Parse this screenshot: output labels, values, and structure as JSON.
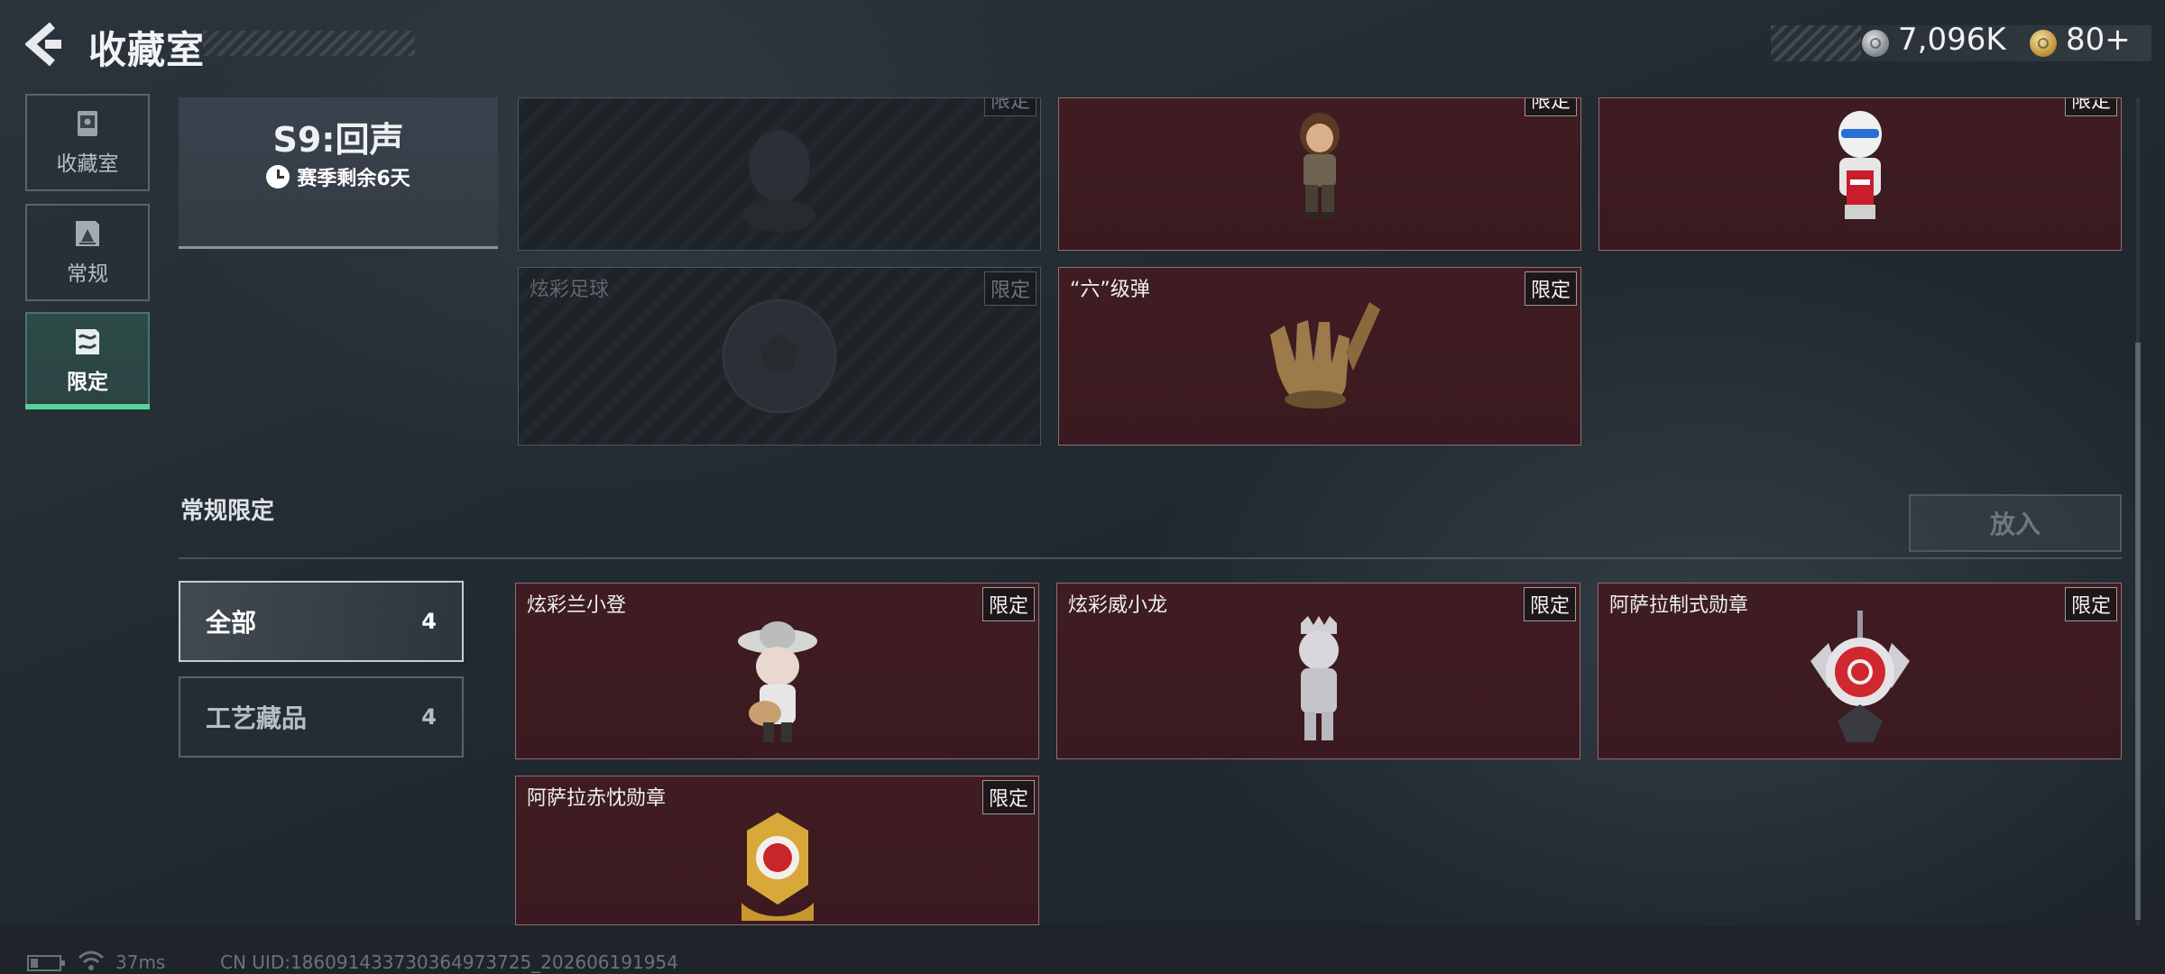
{
  "header": {
    "title": "收藏室",
    "currencies": [
      {
        "icon": "silver-coin-icon",
        "value": "7,096K"
      },
      {
        "icon": "gold-coin-icon",
        "value": "80+"
      }
    ]
  },
  "nav": {
    "items": [
      {
        "label": "收藏室",
        "icon": "collection-cabinet-icon",
        "active": false
      },
      {
        "label": "常规",
        "icon": "regular-frame-icon",
        "active": false
      },
      {
        "label": "限定",
        "icon": "limited-frame-icon",
        "active": true
      }
    ]
  },
  "season": {
    "title": "S9:回声",
    "remaining": "赛季剩余6天"
  },
  "season_items": [
    {
      "name": "",
      "badge": "",
      "locked": true,
      "art": "silhouette-icon"
    },
    {
      "name": "",
      "badge": "",
      "locked": false,
      "art": "adventurer-figurine"
    },
    {
      "name": "",
      "badge": "",
      "locked": false,
      "art": "kfc-colonel-figurine"
    },
    {
      "name": "炫彩足球",
      "badge": "限定",
      "locked": true,
      "art": "football-icon"
    },
    {
      "name": "“六”级弹",
      "badge": "限定",
      "locked": false,
      "art": "shaka-hand-sculpture"
    }
  ],
  "section": {
    "title": "常规限定",
    "put_in_button": "放入"
  },
  "filters": [
    {
      "label": "全部",
      "count": "4",
      "active": true
    },
    {
      "label": "工艺藏品",
      "count": "4",
      "active": false
    }
  ],
  "limited_items": [
    {
      "name": "炫彩兰小登",
      "badge": "限定",
      "art": "mariachi-figurine"
    },
    {
      "name": "炫彩威小龙",
      "badge": "限定",
      "art": "silver-dragon-figurine"
    },
    {
      "name": "阿萨拉制式勋章",
      "badge": "限定",
      "art": "red-medal"
    },
    {
      "name": "阿萨拉赤忱勋章",
      "badge": "限定",
      "art": "gold-medal"
    }
  ],
  "status": {
    "ping": "37ms",
    "uid": "CN UID:186091433730364973725_202606191954"
  },
  "colors": {
    "accent": "#55d39b",
    "card_red": "#3f1c22",
    "background": "#222a31"
  }
}
